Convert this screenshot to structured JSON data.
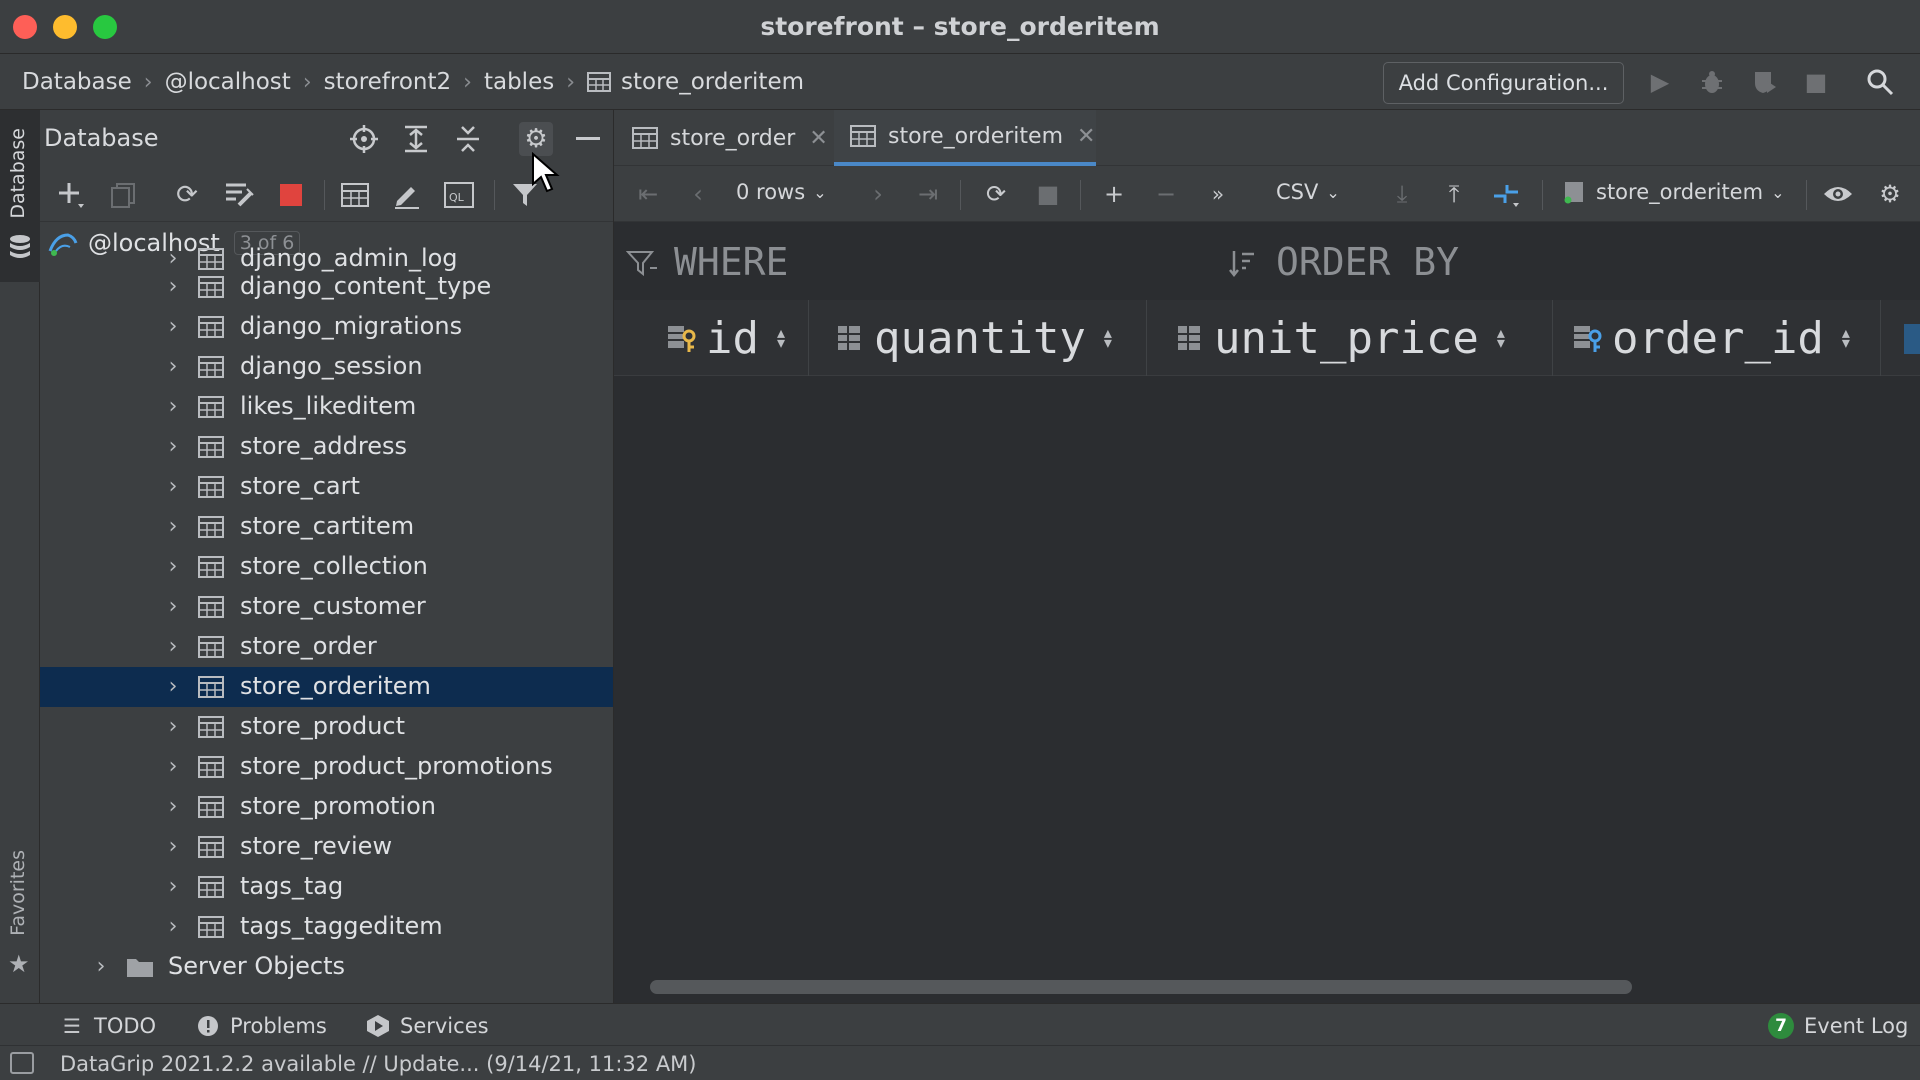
{
  "window": {
    "title": "storefront – store_orderitem"
  },
  "breadcrumbs": [
    "Database",
    "@localhost",
    "storefront2",
    "tables",
    "store_orderitem"
  ],
  "run_config": {
    "label": "Add Configuration..."
  },
  "left_strip": {
    "database_label": "Database",
    "favorites_label": "Favorites"
  },
  "db_panel": {
    "title": "Database",
    "root": {
      "label": "@localhost",
      "badge": "3 of 6"
    },
    "partial_item": "django_admin_log",
    "items": [
      "django_content_type",
      "django_migrations",
      "django_session",
      "likes_likeditem",
      "store_address",
      "store_cart",
      "store_cartitem",
      "store_collection",
      "store_customer",
      "store_order",
      "store_orderitem",
      "store_product",
      "store_product_promotions",
      "store_promotion",
      "store_review",
      "tags_tag",
      "tags_taggeditem"
    ],
    "selected_item": "store_orderitem",
    "server_objects": "Server Objects"
  },
  "editor": {
    "tabs": [
      {
        "label": "store_order",
        "active": false
      },
      {
        "label": "store_orderitem",
        "active": true
      }
    ],
    "toolbar": {
      "rows": "0 rows",
      "format": "CSV",
      "datasource": "store_orderitem"
    },
    "filter": {
      "where": "WHERE",
      "order_by": "ORDER BY"
    },
    "columns": [
      {
        "name": "id",
        "key": "primary"
      },
      {
        "name": "quantity",
        "key": "none"
      },
      {
        "name": "unit_price",
        "key": "none"
      },
      {
        "name": "order_id",
        "key": "foreign"
      }
    ]
  },
  "bottom_bar": {
    "todo": "TODO",
    "problems": "Problems",
    "services": "Services",
    "event_log": "Event Log",
    "event_count": "7"
  },
  "status_bar": {
    "message": "DataGrip 2021.2.2 available // Update... (9/14/21, 11:32 AM)"
  },
  "colors": {
    "accent": "#4a88c7",
    "selection": "#0d2c4f",
    "stop_red": "#e0443e",
    "key_yellow": "#e8b84a",
    "fk_blue": "#4aa0e8"
  }
}
